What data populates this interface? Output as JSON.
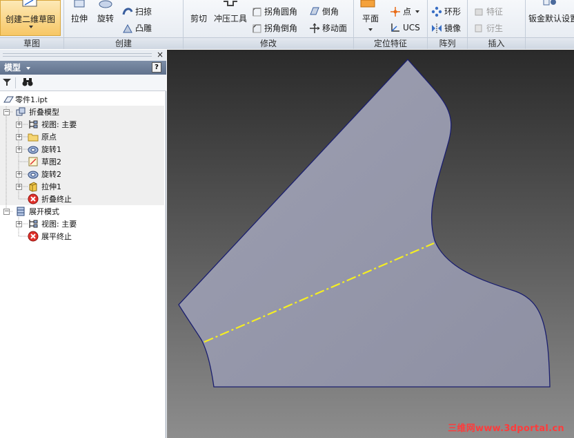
{
  "ribbon": {
    "panels": [
      {
        "id": "sketch",
        "label": "草图"
      },
      {
        "id": "create",
        "label": "创建"
      },
      {
        "id": "modify",
        "label": "修改"
      },
      {
        "id": "locate",
        "label": "定位特征"
      },
      {
        "id": "pattern",
        "label": "阵列"
      },
      {
        "id": "insert",
        "label": "插入"
      }
    ],
    "sketch": {
      "create_2d_sketch": "创建二维草图"
    },
    "create": {
      "extrude": "拉伸",
      "revolve": "旋转",
      "sweep": "扫掠",
      "emboss": "凸雕"
    },
    "modify": {
      "cut": "剪切",
      "punch": "冲压工具",
      "corner_round": "拐角圆角",
      "corner_chamfer": "拐角倒角",
      "chamfer": "倒角",
      "move_face": "移动面"
    },
    "locate": {
      "plane": "平面",
      "point": "点",
      "ucs": "UCS"
    },
    "pattern": {
      "circular": "环形",
      "mirror": "镜像"
    },
    "insert": {
      "feature": "特征",
      "derive": "衍生"
    },
    "sheet_metal": {
      "defaults": "钣金默认设置"
    }
  },
  "browser": {
    "title": "模型",
    "help": "?",
    "close": "×",
    "tree": [
      {
        "label": "零件1.ipt"
      },
      {
        "label": "折叠模型"
      },
      {
        "label": "视图: 主要"
      },
      {
        "label": "原点"
      },
      {
        "label": "旋转1"
      },
      {
        "label": "草图2"
      },
      {
        "label": "旋转2"
      },
      {
        "label": "拉伸1"
      },
      {
        "label": "折叠终止"
      },
      {
        "label": "展开模式"
      },
      {
        "label": "视图: 主要"
      },
      {
        "label": "展平终止"
      }
    ]
  },
  "viewport": {
    "watermark": "三维网www.3dportal.cn",
    "face_color": "#9d9fb2",
    "edge_color": "#1a1e6e",
    "bend_line_color": "#f5ee22"
  }
}
